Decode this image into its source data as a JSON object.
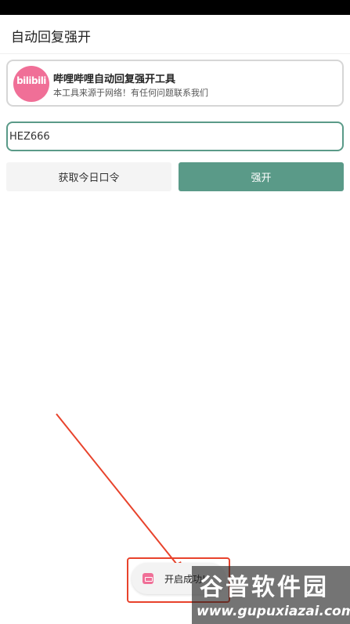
{
  "app_bar": {
    "title": "自动回复强开"
  },
  "info_card": {
    "logo_text": "bilibili",
    "title": "哔哩哔哩自动回复强开工具",
    "subtitle": "本工具来源于网络！有任何问题联系我们"
  },
  "code_input": {
    "value": "HEZ666"
  },
  "buttons": {
    "get_code": "获取今日口令",
    "open": "强开"
  },
  "toast": {
    "text": "开启成功!"
  },
  "watermark": {
    "title": "谷普软件园",
    "url": "www.gupuxiazai.com"
  },
  "colors": {
    "accent": "#5a9a88",
    "brand_pink": "#f06f97",
    "annotation_red": "#e8432c"
  }
}
